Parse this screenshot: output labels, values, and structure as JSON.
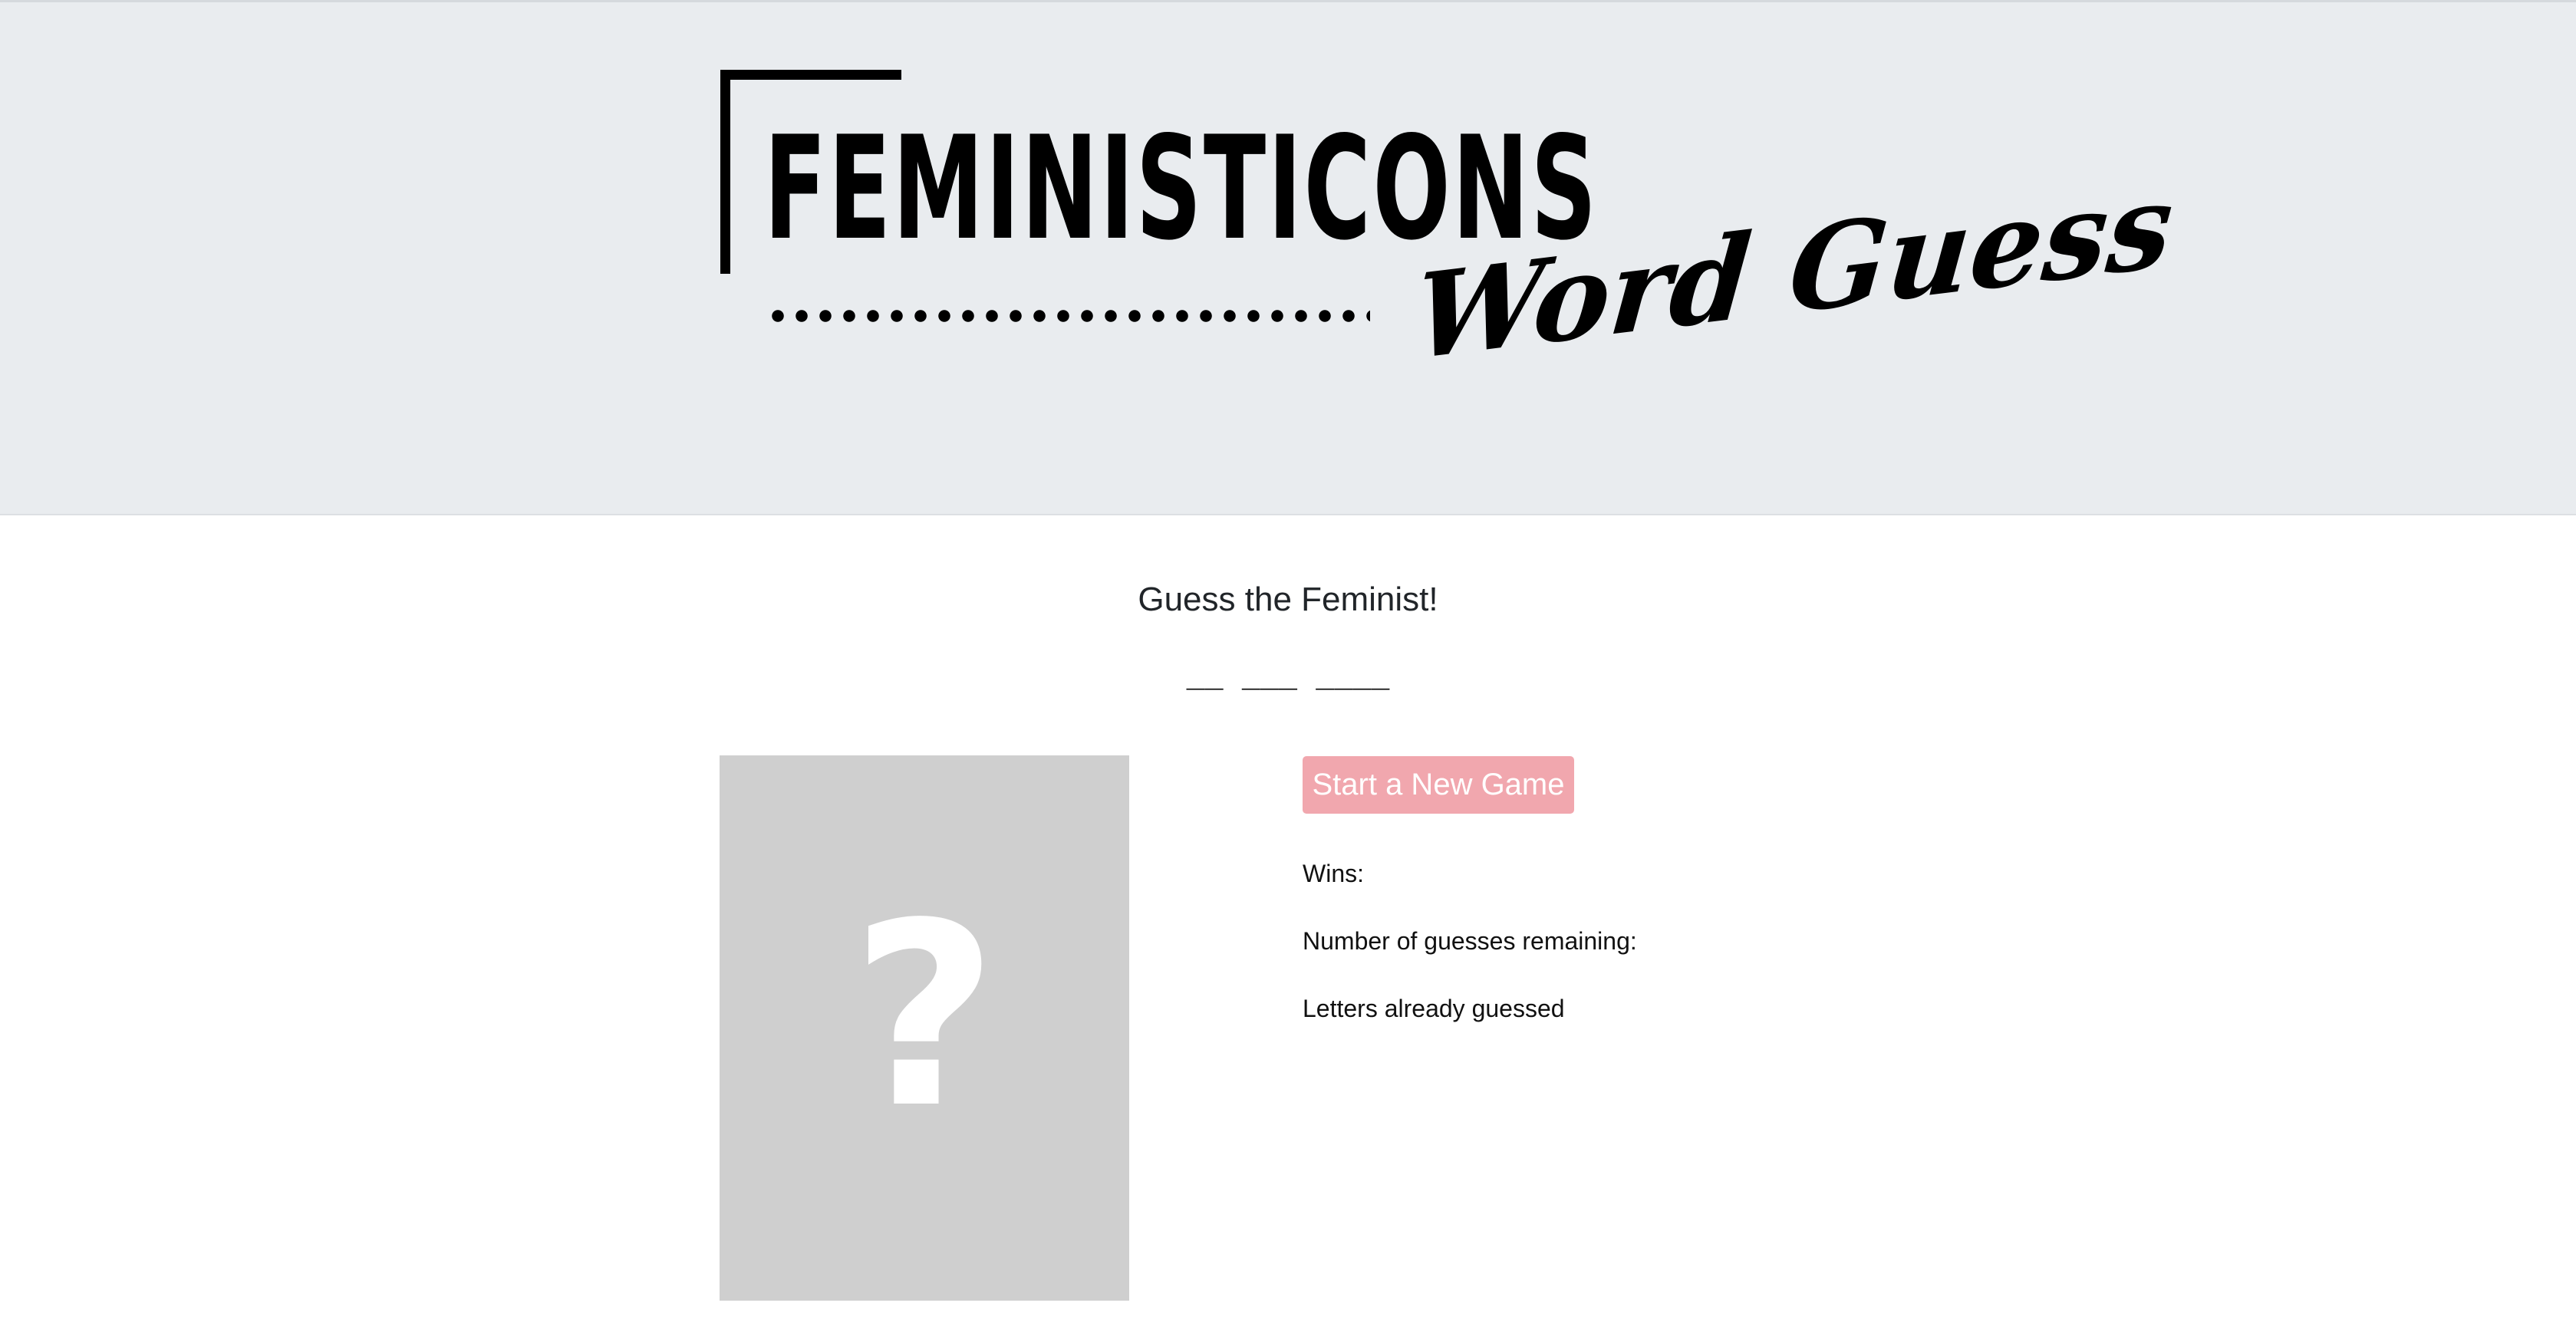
{
  "header": {
    "logo_main": "FEMINISTICONS",
    "logo_sub": "Word Guess"
  },
  "game": {
    "title": "Guess the Feminist!",
    "word_blanks": "__ ___ ____",
    "portrait_placeholder": "?",
    "new_game_label": "Start a New Game",
    "wins_label": "Wins:",
    "guesses_label": "Number of guesses remaining:",
    "letters_label": "Letters already guessed"
  },
  "colors": {
    "header_bg": "#e9ecef",
    "button_bg": "#f1a7ae",
    "portrait_bg": "#cfcfcf"
  }
}
